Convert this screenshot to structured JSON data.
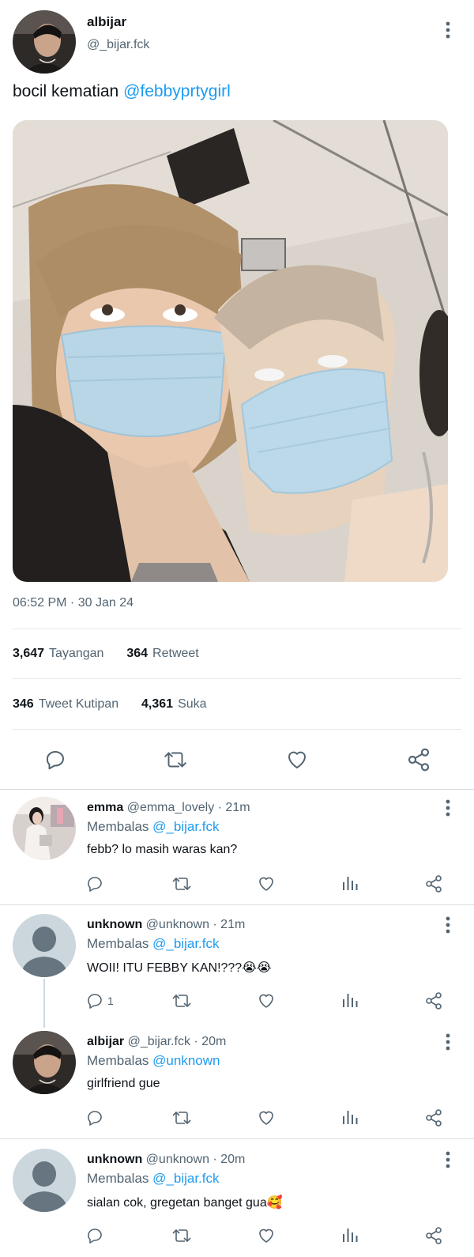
{
  "main_tweet": {
    "display_name": "albijar",
    "handle": "@_bijar.fck",
    "text_prefix": "bocil kematian ",
    "text_mention": "@febbyprtygirl",
    "timestamp": "06:52 PM · 30 Jan 24",
    "stats": {
      "views_count": "3,647",
      "views_label": "Tayangan",
      "retweets_count": "364",
      "retweets_label": "Retweet",
      "quotes_count": "346",
      "quotes_label": "Tweet Kutipan",
      "likes_count": "4,361",
      "likes_label": "Suka"
    }
  },
  "replies": [
    {
      "display_name": "emma",
      "handle_time": "@emma_lovely · 21m",
      "replying_label": "Membalas",
      "replying_to": "@_bijar.fck",
      "text": "febb? lo masih waras kan?",
      "reply_count": ""
    },
    {
      "display_name": "unknown",
      "handle_time": "@unknown · 21m",
      "replying_label": "Membalas",
      "replying_to": "@_bijar.fck",
      "text": "WOII! ITU FEBBY KAN!???😭😭",
      "reply_count": "1"
    },
    {
      "display_name": "albijar",
      "handle_time": "@_bijar.fck · 20m",
      "replying_label": "Membalas",
      "replying_to": "@unknown",
      "text": "girlfriend gue",
      "reply_count": ""
    },
    {
      "display_name": "unknown",
      "handle_time": "@unknown · 20m",
      "replying_label": "Membalas",
      "replying_to": "@_bijar.fck",
      "text": "sialan cok, gregetan banget gua🥰",
      "reply_count": ""
    }
  ],
  "icons": [
    "more-vertical-icon",
    "reply-icon",
    "retweet-icon",
    "like-icon",
    "share-icon",
    "analytics-icon"
  ],
  "colors": {
    "link": "#1d9bf0",
    "secondary_text": "#536471",
    "icon": "#536471",
    "divider": "#e6e9eb"
  }
}
